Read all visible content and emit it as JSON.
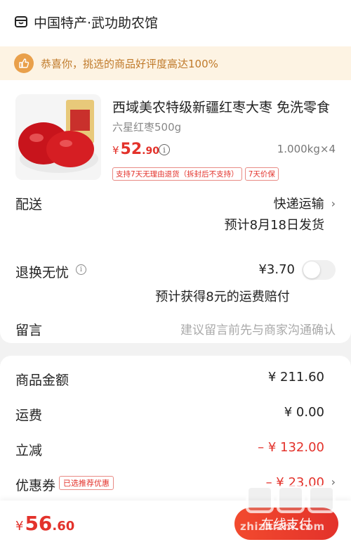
{
  "shop": {
    "name": "中国特产·武功助农馆",
    "icon": "store-icon"
  },
  "banner": {
    "text": "恭喜你，挑选的商品好评度高达100%",
    "icon": "thumbs-up-icon"
  },
  "product": {
    "title": "西域美农特级新疆红枣大枣 免洗零食",
    "spec": "六星红枣500g",
    "price_symbol": "¥",
    "price_int": "52",
    "price_dec": ".90",
    "quantity": "1.000kg×4",
    "tags": [
      "支持7天无理由退货（拆封后不支持）",
      "7天价保"
    ]
  },
  "delivery": {
    "label": "配送",
    "method": "快递运输",
    "estimate": "预计8月18日发货"
  },
  "worry_free": {
    "label": "退换无忧",
    "price": "¥3.70",
    "note": "预计获得8元的运费赔付",
    "enabled": false
  },
  "message": {
    "label": "留言",
    "placeholder": "建议留言前先与商家沟通确认"
  },
  "summary": {
    "goods_label": "商品金额",
    "goods_value": "¥ 211.60",
    "shipping_label": "运费",
    "shipping_value": "¥ 0.00",
    "discount_label": "立减",
    "discount_value": "– ¥ 132.00",
    "coupon_label": "优惠券",
    "coupon_tag": "已选推荐优惠",
    "coupon_value": "– ¥ 23.00"
  },
  "footer": {
    "total_symbol": "¥",
    "total_int": "56",
    "total_dec": ".60",
    "pay_label": "在线支付"
  },
  "watermark": {
    "url": "zhizhizhi.com"
  },
  "colors": {
    "accent": "#e3322b",
    "banner_bg": "#fdf3e3",
    "banner_text": "#c07a2a"
  }
}
